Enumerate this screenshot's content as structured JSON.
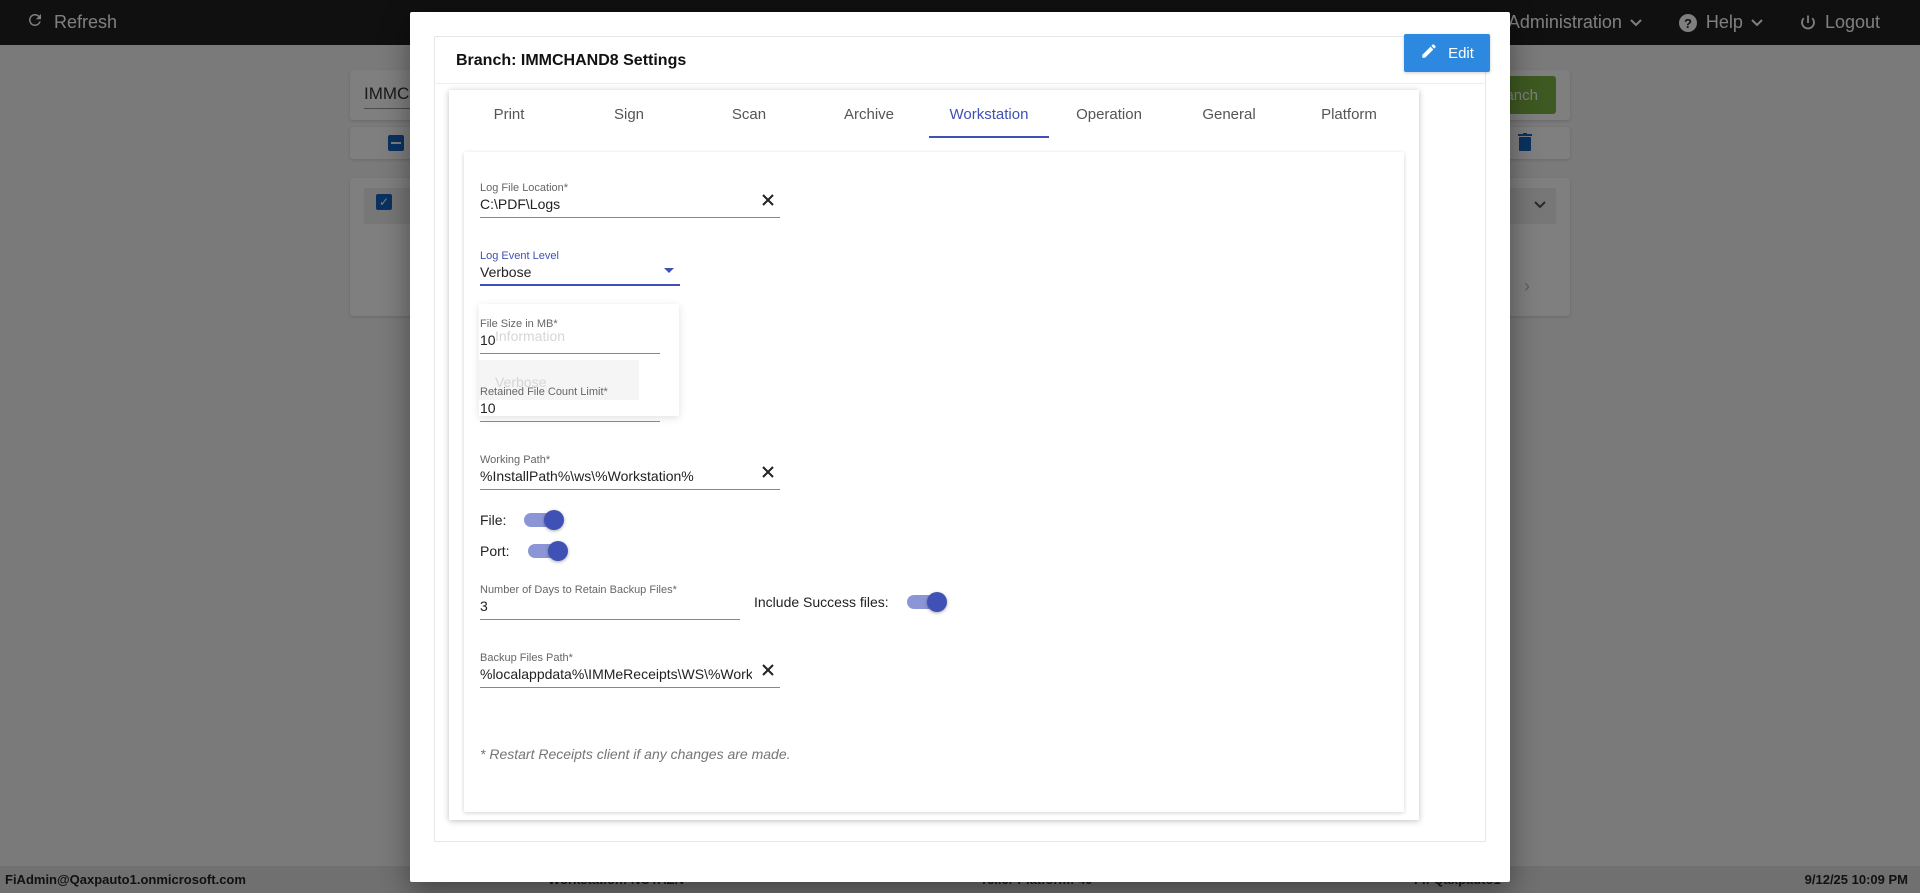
{
  "topbar": {
    "refresh_label": "Refresh",
    "administration_label": "Administration",
    "help_label": "Help",
    "logout_label": "Logout"
  },
  "background": {
    "search_value": "IMMCI",
    "branch_button_label": "anch"
  },
  "statusbar": {
    "user": "FiAdmin@Qaxpauto1.onmicrosoft.com",
    "workstation": "Workstation: NOTAZN",
    "teller_platform": "Teller Platform: 40",
    "fi": "FI: Qaxpauto1",
    "datetime": "9/12/25 10:09 PM"
  },
  "modal": {
    "title": "Branch: IMMCHAND8 Settings",
    "edit_label": "Edit",
    "tabs": [
      {
        "label": "Print"
      },
      {
        "label": "Sign"
      },
      {
        "label": "Scan"
      },
      {
        "label": "Archive"
      },
      {
        "label": "Workstation"
      },
      {
        "label": "Operation"
      },
      {
        "label": "General"
      },
      {
        "label": "Platform"
      }
    ],
    "active_tab": "Workstation",
    "workstation": {
      "log_file_location": {
        "label": "Log File Location*",
        "value": "C:\\PDF\\Logs"
      },
      "log_event_level": {
        "label": "Log Event Level",
        "value": "Verbose",
        "options": [
          "Information",
          "Verbose"
        ]
      },
      "file_size": {
        "label": "File Size in MB*",
        "value": "10"
      },
      "retained_file_count": {
        "label": "Retained File Count Limit*",
        "value": "10"
      },
      "working_path": {
        "label": "Working Path*",
        "value": "%InstallPath%\\ws\\%Workstation%"
      },
      "file_toggle": {
        "label": "File:",
        "on": true
      },
      "port_toggle": {
        "label": "Port:",
        "on": true
      },
      "days_retain_backup": {
        "label": "Number of Days to Retain Backup Files*",
        "value": "3"
      },
      "include_success": {
        "label": "Include Success files:",
        "on": true
      },
      "backup_files_path": {
        "label": "Backup Files Path*",
        "value": "%localappdata%\\IMMeReceipts\\WS\\%Workstation%"
      },
      "note": "* Restart Receipts client if any changes are made."
    }
  },
  "colors": {
    "accent": "#3f51b5",
    "edit_button": "#2d88e0",
    "topbar": "#212121"
  }
}
